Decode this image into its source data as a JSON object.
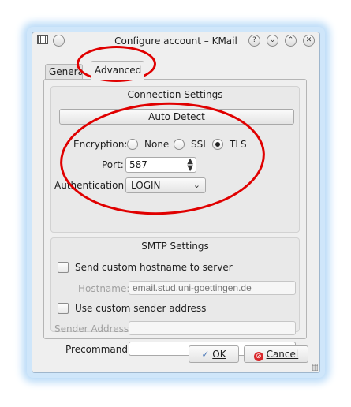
{
  "window": {
    "title": "Configure account – KMail",
    "controls": [
      "?",
      "⌄",
      "⌃",
      "✕"
    ]
  },
  "tabs": [
    {
      "label": "General",
      "active": false
    },
    {
      "label": "Advanced",
      "active": true
    }
  ],
  "connection": {
    "title": "Connection Settings",
    "auto_detect_label": "Auto Detect",
    "encryption_label": "Encryption:",
    "encryption_options": [
      {
        "label": "None",
        "checked": false
      },
      {
        "label": "SSL",
        "checked": false
      },
      {
        "label": "TLS",
        "checked": true
      }
    ],
    "port_label": "Port:",
    "port_value": "587",
    "auth_label": "Authentication:",
    "auth_value": "LOGIN"
  },
  "smtp": {
    "title": "SMTP Settings",
    "send_hostname_label": "Send custom hostname to server",
    "hostname_label": "Hostname:",
    "hostname_placeholder": "email.stud.uni-goettingen.de",
    "custom_sender_label": "Use custom sender address",
    "sender_label": "Sender Address:",
    "precommand_label": "Precommand:"
  },
  "buttons": {
    "ok": "OK",
    "cancel": "Cancel"
  },
  "colors": {
    "annotation": "#e00000",
    "window_glow": "#bcdcf8",
    "cancel_icon": "#d9262a",
    "ok_icon": "#4a78b8"
  },
  "icons": {
    "ok": "checkmark-icon",
    "cancel": "cancel-icon"
  }
}
